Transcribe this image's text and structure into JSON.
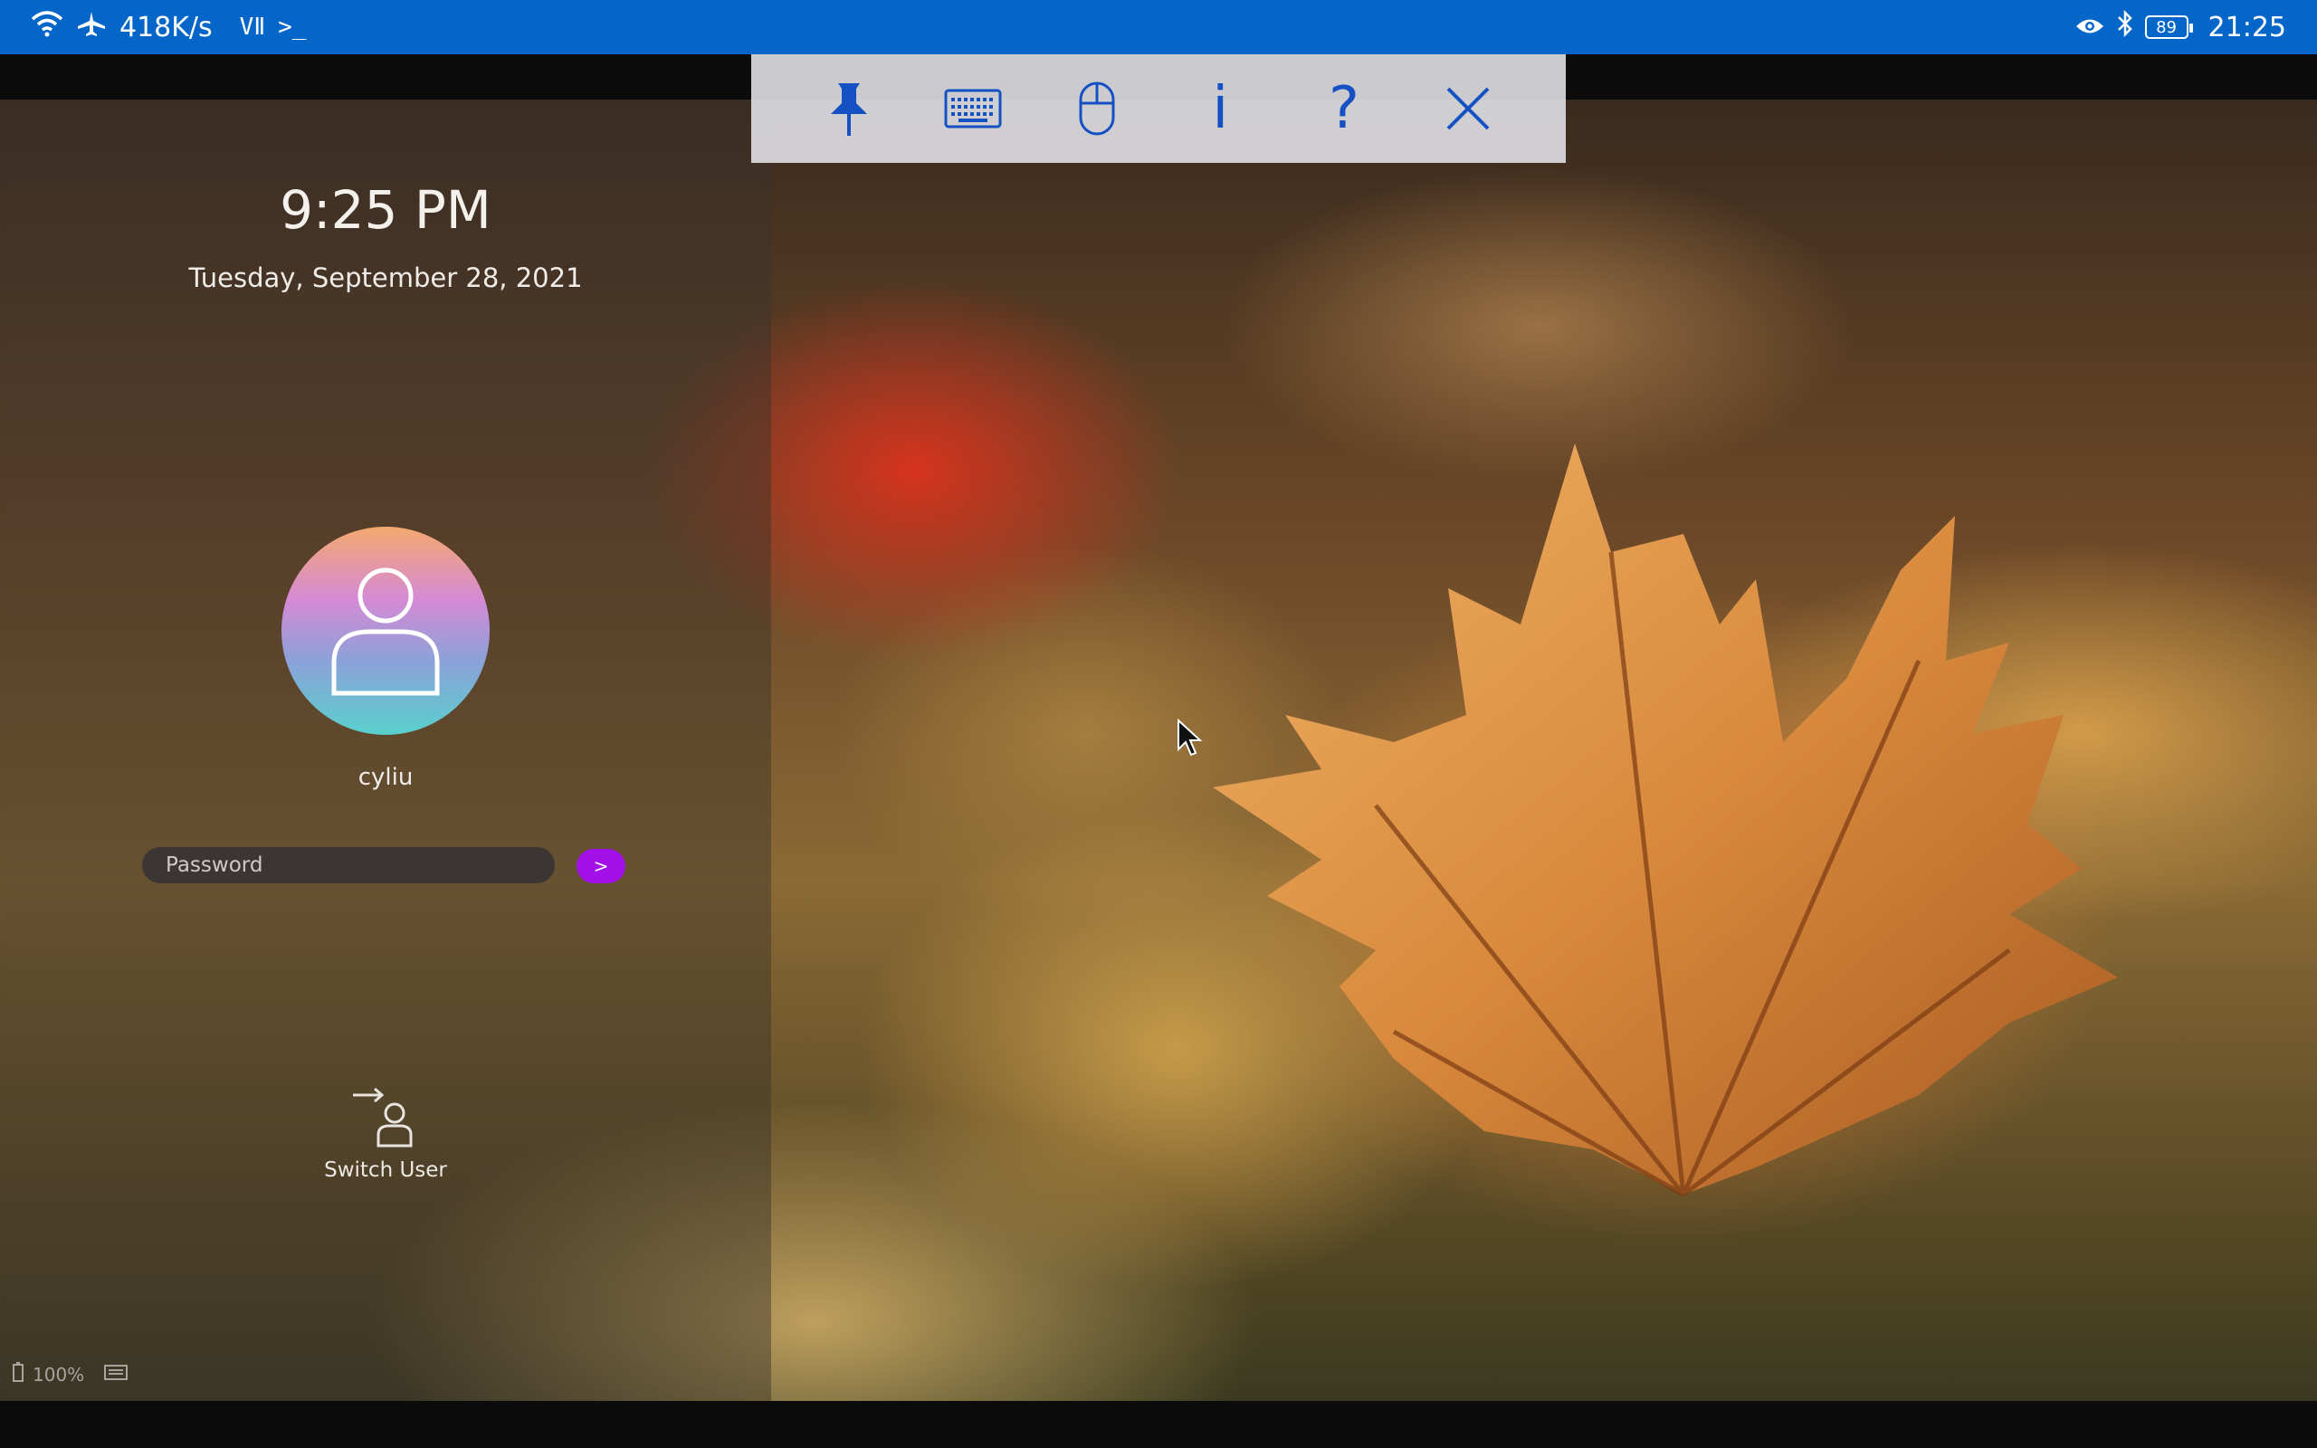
{
  "status_bar": {
    "net_speed": "418K/s",
    "volte": "VⅡ",
    "terminal_glyph": ">_",
    "battery": "89",
    "time": "21:25",
    "icons": [
      "wifi-icon",
      "airplane-icon",
      "eye-icon",
      "bluetooth-icon",
      "battery-icon"
    ]
  },
  "toolbar": {
    "buttons": [
      {
        "name": "pin",
        "icon": "pin-icon"
      },
      {
        "name": "keyboard",
        "icon": "keyboard-icon"
      },
      {
        "name": "mouse",
        "icon": "mouse-icon"
      },
      {
        "name": "info",
        "glyph": "i"
      },
      {
        "name": "help",
        "glyph": "?"
      },
      {
        "name": "close",
        "icon": "close-icon"
      }
    ],
    "color": "#1651c4"
  },
  "login": {
    "time": "9:25 PM",
    "date": "Tuesday, September 28, 2021",
    "username": "cyliu",
    "password_placeholder": "Password",
    "submit_label": ">",
    "switch_user_label": "Switch User",
    "battery_percent": "100%"
  },
  "colors": {
    "status_bar": "#0566c9",
    "submit_button": "#a310e8"
  }
}
